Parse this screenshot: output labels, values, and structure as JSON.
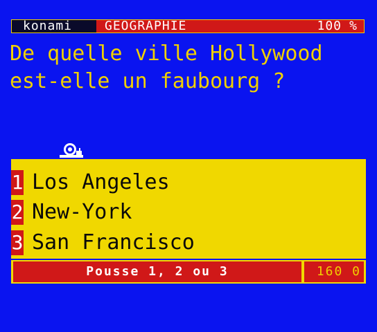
{
  "header": {
    "brand": "konami",
    "category": "GEOGRAPHIE",
    "score": "100",
    "percent_sign": "%"
  },
  "question": {
    "line1": "De quelle ville Hollywood",
    "line2": "est-elle un faubourg ?"
  },
  "answers": [
    {
      "number": "1",
      "label": "Los Angeles"
    },
    {
      "number": "2",
      "label": "New-York"
    },
    {
      "number": "3",
      "label": "San Francisco"
    }
  ],
  "footer": {
    "prompt": "Pousse 1, 2 ou 3",
    "counter": "160 0"
  },
  "colors": {
    "background": "#0a14f0",
    "yellow": "#f0d800",
    "red": "#d01818"
  },
  "icons": {
    "mascot": "snail-mascot-icon"
  }
}
